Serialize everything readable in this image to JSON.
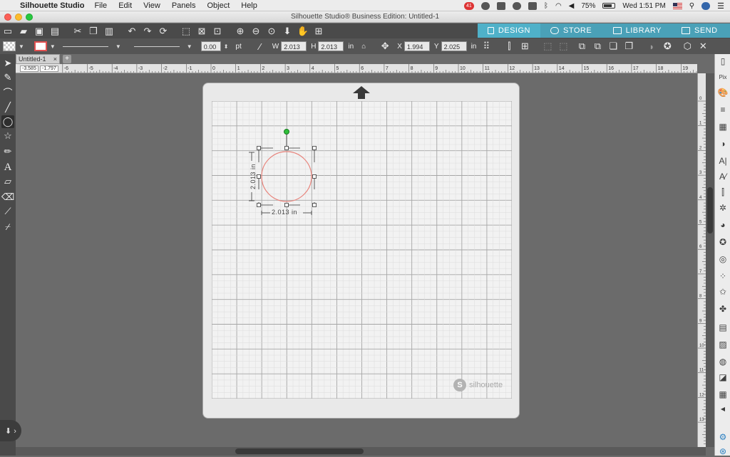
{
  "menubar": {
    "app_name": "Silhouette Studio",
    "menus": [
      "File",
      "Edit",
      "View",
      "Panels",
      "Object",
      "Help"
    ],
    "battery": "75%",
    "clock": "Wed 1:51 PM",
    "notification_badge": "41"
  },
  "window": {
    "title": "Silhouette Studio® Business Edition: Untitled-1"
  },
  "nav_tabs": [
    {
      "label": "DESIGN",
      "icon": "grid-icon",
      "active": true
    },
    {
      "label": "STORE",
      "icon": "store-icon",
      "active": false
    },
    {
      "label": "LIBRARY",
      "icon": "library-icon",
      "active": false
    },
    {
      "label": "SEND",
      "icon": "send-icon",
      "active": false
    }
  ],
  "line_options": {
    "line_width": "0.00",
    "unit": "pt"
  },
  "transform": {
    "w_label": "W",
    "w_value": "2.013",
    "h_label": "H",
    "h_value": "2.013",
    "size_unit": "in",
    "x_label": "X",
    "x_value": "1.994",
    "y_label": "Y",
    "y_value": "2.025",
    "pos_unit": "in"
  },
  "document_tab": {
    "name": "Untitled-1",
    "close": "×",
    "add": "+"
  },
  "rulers": {
    "cursor_x": "-3.585",
    "cursor_y": "-1.797",
    "h_labels": [
      "-6",
      "-5",
      "-4",
      "-3",
      "-2",
      "-1",
      "0",
      "1",
      "2",
      "3",
      "4",
      "5",
      "6",
      "7",
      "8",
      "9",
      "10",
      "11",
      "12",
      "13",
      "14",
      "15",
      "16",
      "17",
      "18",
      "19"
    ],
    "v_labels": [
      "0",
      "1",
      "2",
      "3",
      "4",
      "5",
      "6",
      "7",
      "8",
      "9",
      "10",
      "11",
      "12",
      "13"
    ]
  },
  "selection": {
    "width_dimension": "2.013 in",
    "height_dimension": "2.013 in"
  },
  "colors": {
    "circle_stroke": "#e8847c",
    "rotate_handle": "#2fbf3a",
    "design_tab": "#4fb1c9"
  },
  "mat": {
    "brand": "silhouette"
  }
}
